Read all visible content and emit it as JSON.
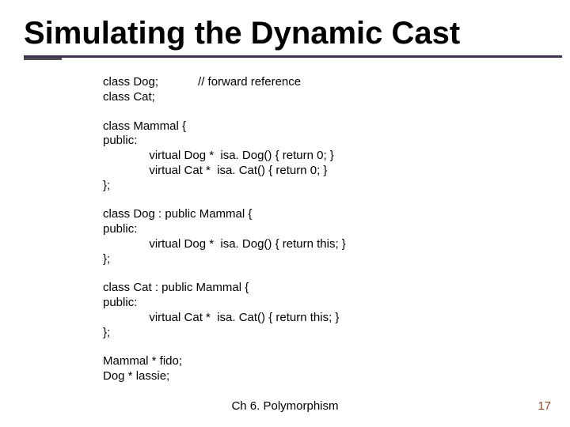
{
  "title": "Simulating the Dynamic Cast",
  "code": {
    "b1l1": "class Dog;            // forward reference",
    "b1l2": "class Cat;",
    "b2l1": "class Mammal {",
    "b2l2": "public:",
    "b2l3": "              virtual Dog *  isa. Dog() { return 0; }",
    "b2l4": "              virtual Cat *  isa. Cat() { return 0; }",
    "b2l5": "};",
    "b3l1": "class Dog : public Mammal {",
    "b3l2": "public:",
    "b3l3": "              virtual Dog *  isa. Dog() { return this; }",
    "b3l4": "};",
    "b4l1": "class Cat : public Mammal {",
    "b4l2": "public:",
    "b4l3": "              virtual Cat *  isa. Cat() { return this; }",
    "b4l4": "};",
    "b5l1": "Mammal * fido;",
    "b5l2": "Dog * lassie;"
  },
  "footer": {
    "center": "Ch 6. Polymorphism",
    "page": "17"
  }
}
